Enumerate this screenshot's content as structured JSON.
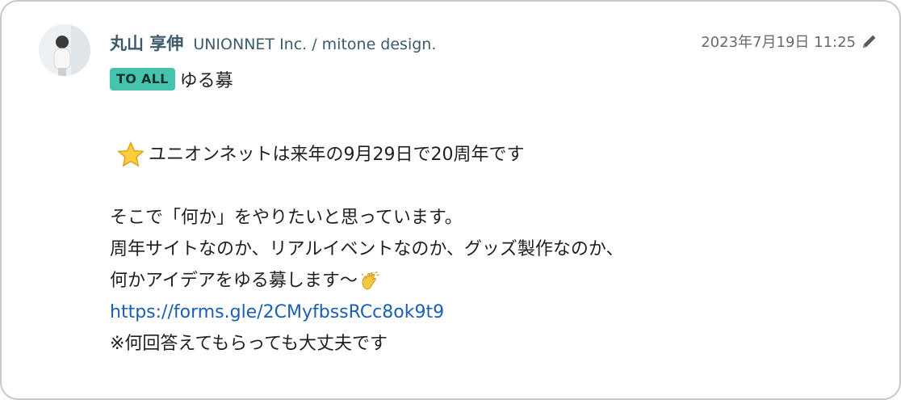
{
  "message": {
    "author": "丸山 享伸",
    "organization": "UNIONNET Inc. / mitone design.",
    "timestamp": "2023年7月19日 11:25",
    "badge": "TO ALL",
    "subject": "ゆる募",
    "lines": {
      "announcement": "ユニオンネットは来年の9月29日で20周年です",
      "line2": "そこで「何か」をやりたいと思っています。",
      "line3": "周年サイトなのか、リアルイベントなのか、グッズ製作なのか、",
      "line4": "何かアイデアをゆる募します〜",
      "link": "https://forms.gle/2CMyfbssRCc8ok9t9",
      "note": "※何回答えてもらっても大丈夫です"
    }
  },
  "icons": {
    "edit": "pencil-icon",
    "star": "star-emoji",
    "wave": "waving-hand-emoji"
  },
  "colors": {
    "badge": "#45c3ad",
    "author": "#3c5a6b",
    "link": "#1a5fb4"
  }
}
